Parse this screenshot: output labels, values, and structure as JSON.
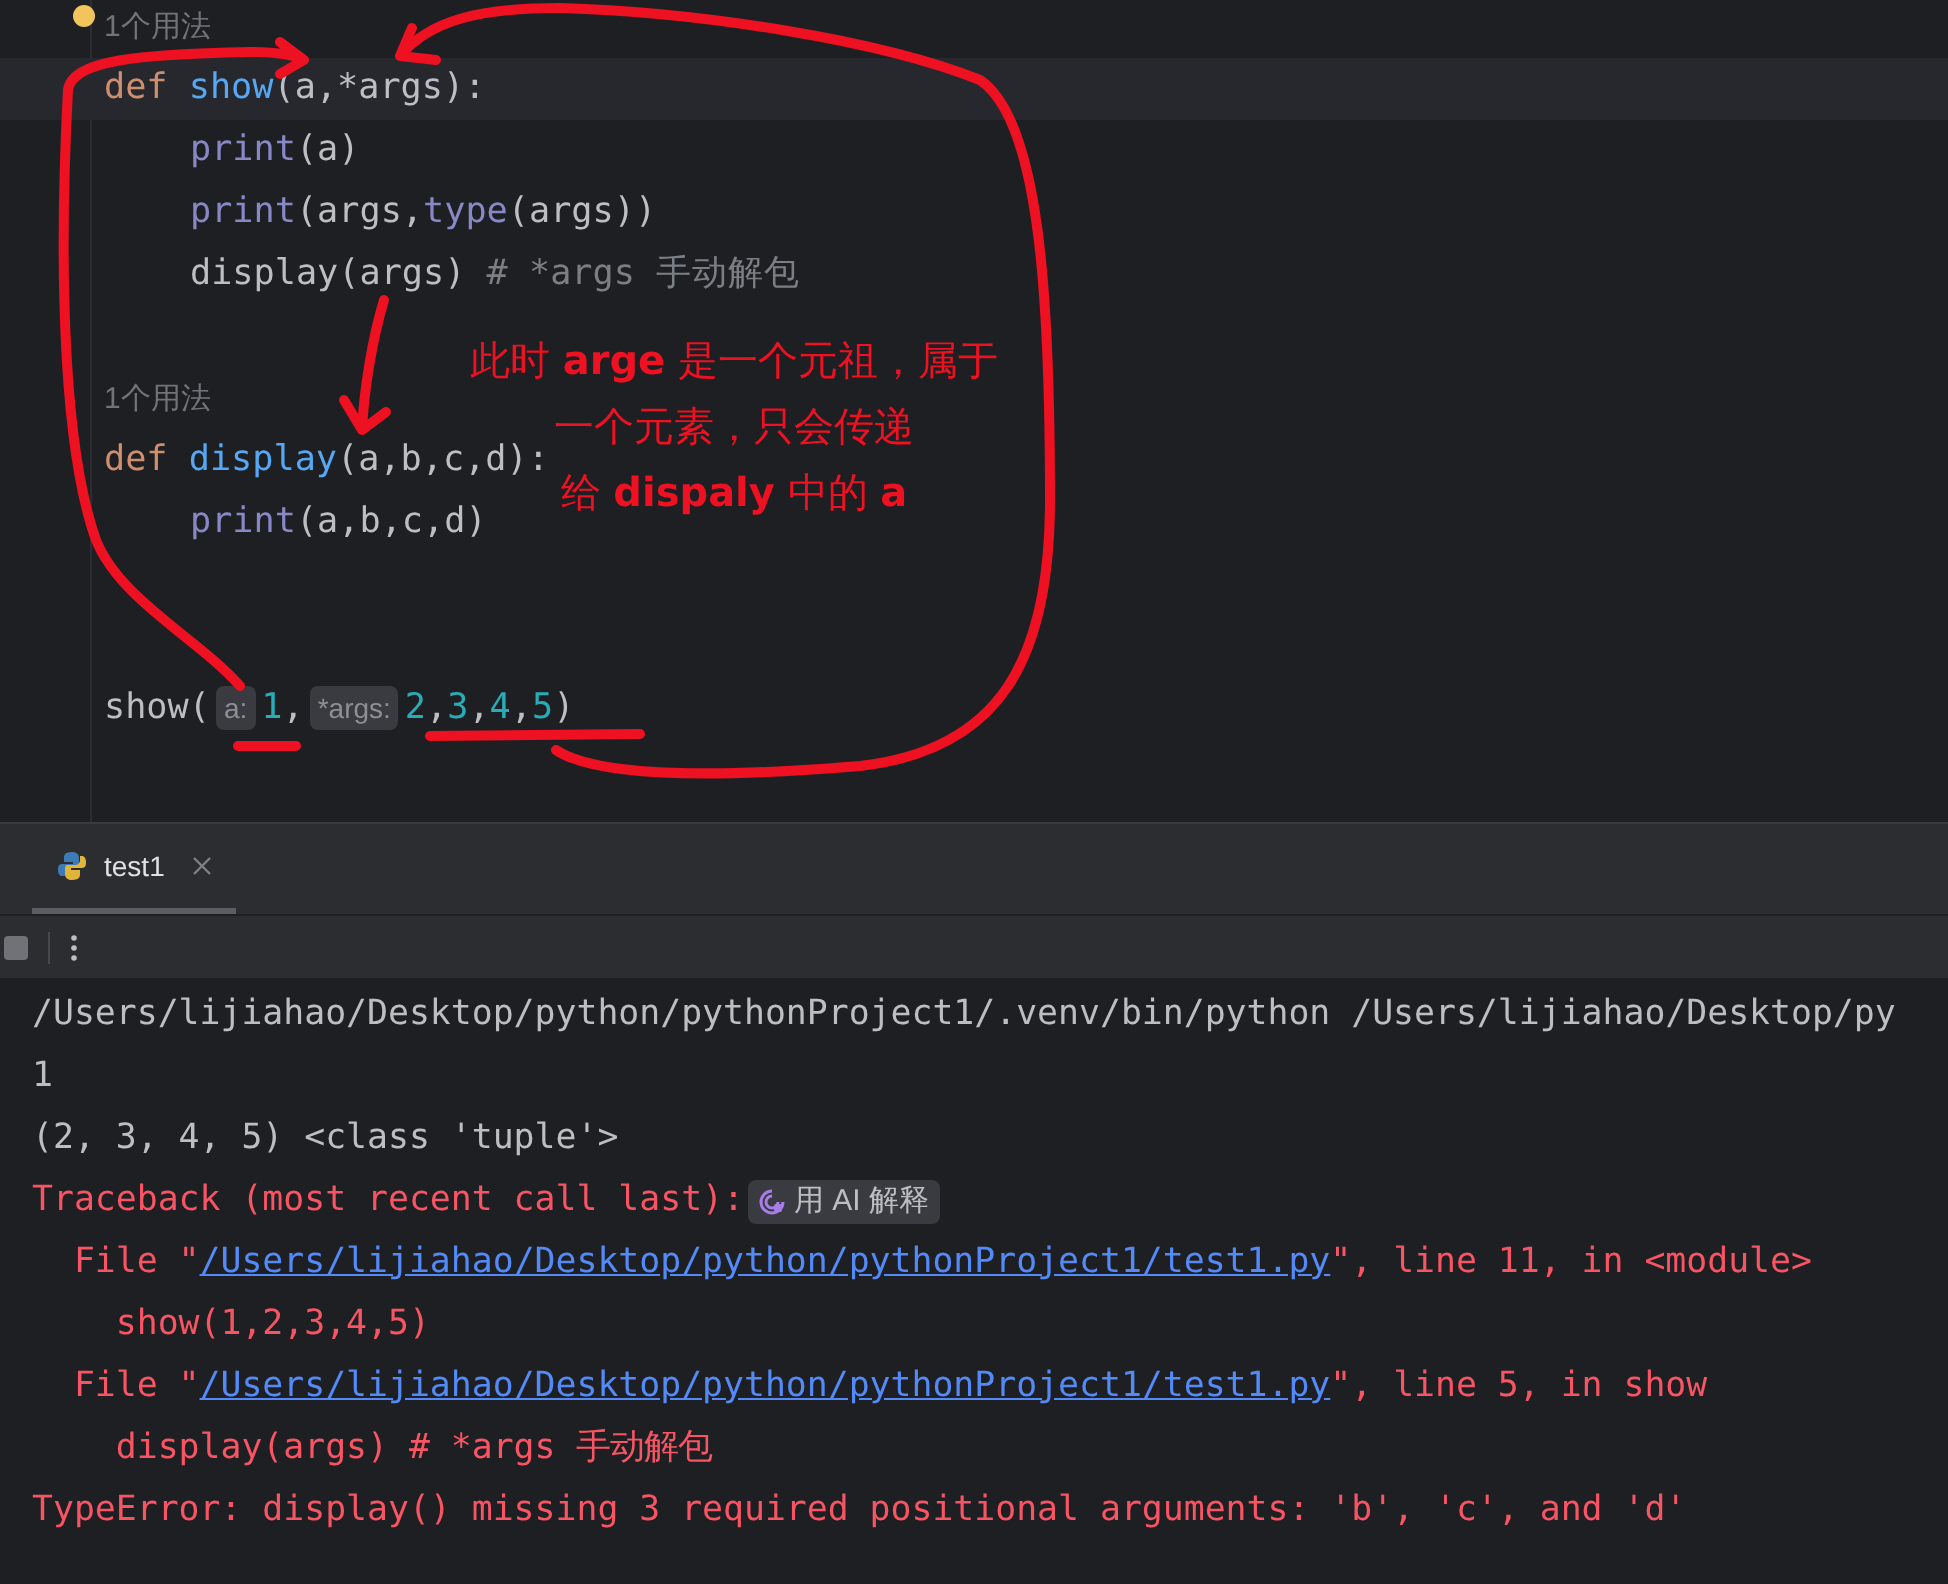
{
  "editor": {
    "lines": [
      {
        "current": false,
        "indented": false,
        "tokens": [
          {
            "kind": "usage",
            "text": "1个用法"
          }
        ]
      },
      {
        "current": true,
        "indented": false,
        "tokens": [
          {
            "kind": "keyword",
            "text": "def "
          },
          {
            "kind": "func",
            "text": "show"
          },
          {
            "kind": "plain",
            "text": "(a,*args):"
          }
        ]
      },
      {
        "current": false,
        "indented": true,
        "tokens": [
          {
            "kind": "builtin",
            "text": "print"
          },
          {
            "kind": "plain",
            "text": "(a)"
          }
        ]
      },
      {
        "current": false,
        "indented": true,
        "tokens": [
          {
            "kind": "builtin",
            "text": "print"
          },
          {
            "kind": "plain",
            "text": "(args,"
          },
          {
            "kind": "builtin",
            "text": "type"
          },
          {
            "kind": "plain",
            "text": "(args))"
          }
        ]
      },
      {
        "current": false,
        "indented": true,
        "tokens": [
          {
            "kind": "plain",
            "text": "display(args) "
          },
          {
            "kind": "comment",
            "text": "# *args 手动解包"
          }
        ]
      },
      {
        "current": false
      },
      {
        "current": false,
        "indented": false,
        "tokens": [
          {
            "kind": "usage",
            "text": "1个用法"
          }
        ]
      },
      {
        "current": false,
        "indented": false,
        "tokens": [
          {
            "kind": "keyword",
            "text": "def "
          },
          {
            "kind": "func",
            "text": "display"
          },
          {
            "kind": "plain",
            "text": "(a,b,c,d):"
          }
        ]
      },
      {
        "current": false,
        "indented": true,
        "tokens": [
          {
            "kind": "builtin",
            "text": "print"
          },
          {
            "kind": "plain",
            "text": "(a,b,c,d)"
          }
        ]
      },
      {
        "current": false
      },
      {
        "current": false
      },
      {
        "current": false,
        "indented": false,
        "tokens": [
          {
            "kind": "plain",
            "text": "show("
          },
          {
            "kind": "hint",
            "text": "a:"
          },
          {
            "kind": "number",
            "text": "1"
          },
          {
            "kind": "plain",
            "text": ","
          },
          {
            "kind": "hint",
            "text": "*args:"
          },
          {
            "kind": "number",
            "text": "2"
          },
          {
            "kind": "plain",
            "text": ","
          },
          {
            "kind": "number",
            "text": "3"
          },
          {
            "kind": "plain",
            "text": ","
          },
          {
            "kind": "number",
            "text": "4"
          },
          {
            "kind": "plain",
            "text": ","
          },
          {
            "kind": "number",
            "text": "5"
          },
          {
            "kind": "plain",
            "text": ")"
          }
        ]
      }
    ]
  },
  "annotation": {
    "lines": [
      "此时 **arge** 是一个元祖，属于",
      "一个元素，只会传递",
      "给 **dispaly** 中的 **a**"
    ]
  },
  "run_panel": {
    "tabs": [
      {
        "label": "test1",
        "selected": true
      }
    ]
  },
  "console": {
    "lines": [
      {
        "segments": [
          {
            "kind": "plain",
            "text": "/Users/lijiahao/Desktop/python/pythonProject1/.venv/bin/python /Users/lijiahao/Desktop/py"
          }
        ]
      },
      {
        "segments": [
          {
            "kind": "plain",
            "text": "1"
          }
        ]
      },
      {
        "segments": [
          {
            "kind": "plain",
            "text": "(2, 3, 4, 5) <class 'tuple'>"
          }
        ]
      },
      {
        "segments": [
          {
            "kind": "error",
            "text": "Traceback (most recent call last):"
          },
          {
            "kind": "ai",
            "text": "用 AI 解释"
          }
        ]
      },
      {
        "segments": [
          {
            "kind": "error",
            "text": "  File \""
          },
          {
            "kind": "link",
            "text": "/Users/lijiahao/Desktop/python/pythonProject1/test1.py"
          },
          {
            "kind": "error",
            "text": "\", line 11, in <module>"
          }
        ]
      },
      {
        "segments": [
          {
            "kind": "error",
            "text": "    show(1,2,3,4,5)"
          }
        ]
      },
      {
        "segments": [
          {
            "kind": "error",
            "text": "  File \""
          },
          {
            "kind": "link",
            "text": "/Users/lijiahao/Desktop/python/pythonProject1/test1.py"
          },
          {
            "kind": "error",
            "text": "\", line 5, in show"
          }
        ]
      },
      {
        "segments": [
          {
            "kind": "error",
            "text": "    display(args) # *args 手动解包"
          }
        ]
      },
      {
        "segments": [
          {
            "kind": "error",
            "text": "TypeError: display() missing 3 required positional arguments: 'b', 'c', and 'd'"
          }
        ]
      }
    ]
  }
}
